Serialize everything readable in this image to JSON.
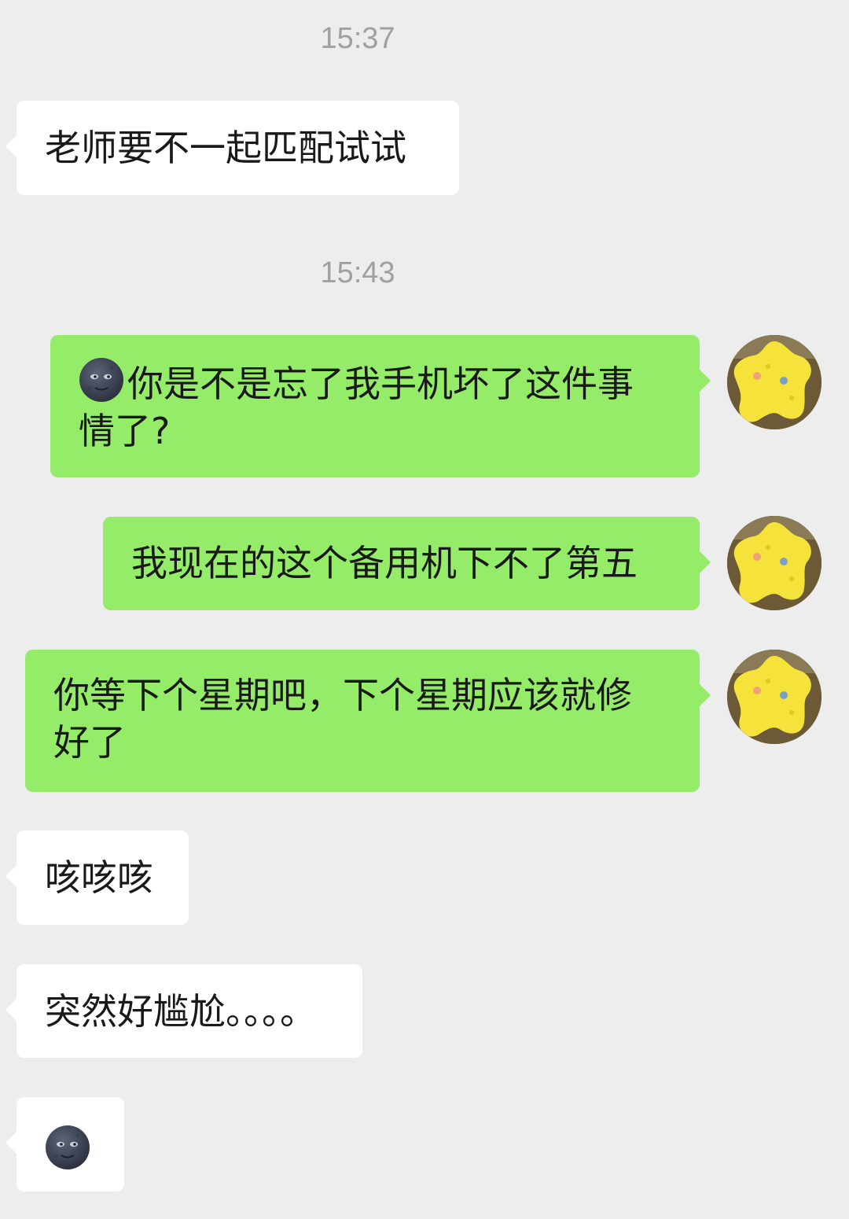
{
  "chat": {
    "timestamps": [
      "15:37",
      "15:43"
    ],
    "messages": [
      {
        "side": "in",
        "text": "老师要不一起匹配试试"
      },
      {
        "side": "out",
        "emoji": "new-moon-face",
        "text_line1": "你是不是忘了我手机坏了这件事",
        "text_line2": "情了?"
      },
      {
        "side": "out",
        "text": "我现在的这个备用机下不了第五"
      },
      {
        "side": "out",
        "text_line1": "你等下个星期吧，下个星期应该就修",
        "text_line2": "好了"
      },
      {
        "side": "in",
        "text": "咳咳咳"
      },
      {
        "side": "in",
        "text": "突然好尴尬。。。。"
      },
      {
        "side": "in",
        "emoji": "new-moon-face"
      }
    ]
  },
  "colors": {
    "background": "#ededed",
    "incoming_bubble": "#ffffff",
    "outgoing_bubble": "#95ec69",
    "timestamp_text": "#a0a0a0"
  },
  "icons": {
    "self_avatar": "yellow-star-plush-avatar-icon",
    "emoji": "new-moon-face-icon"
  }
}
